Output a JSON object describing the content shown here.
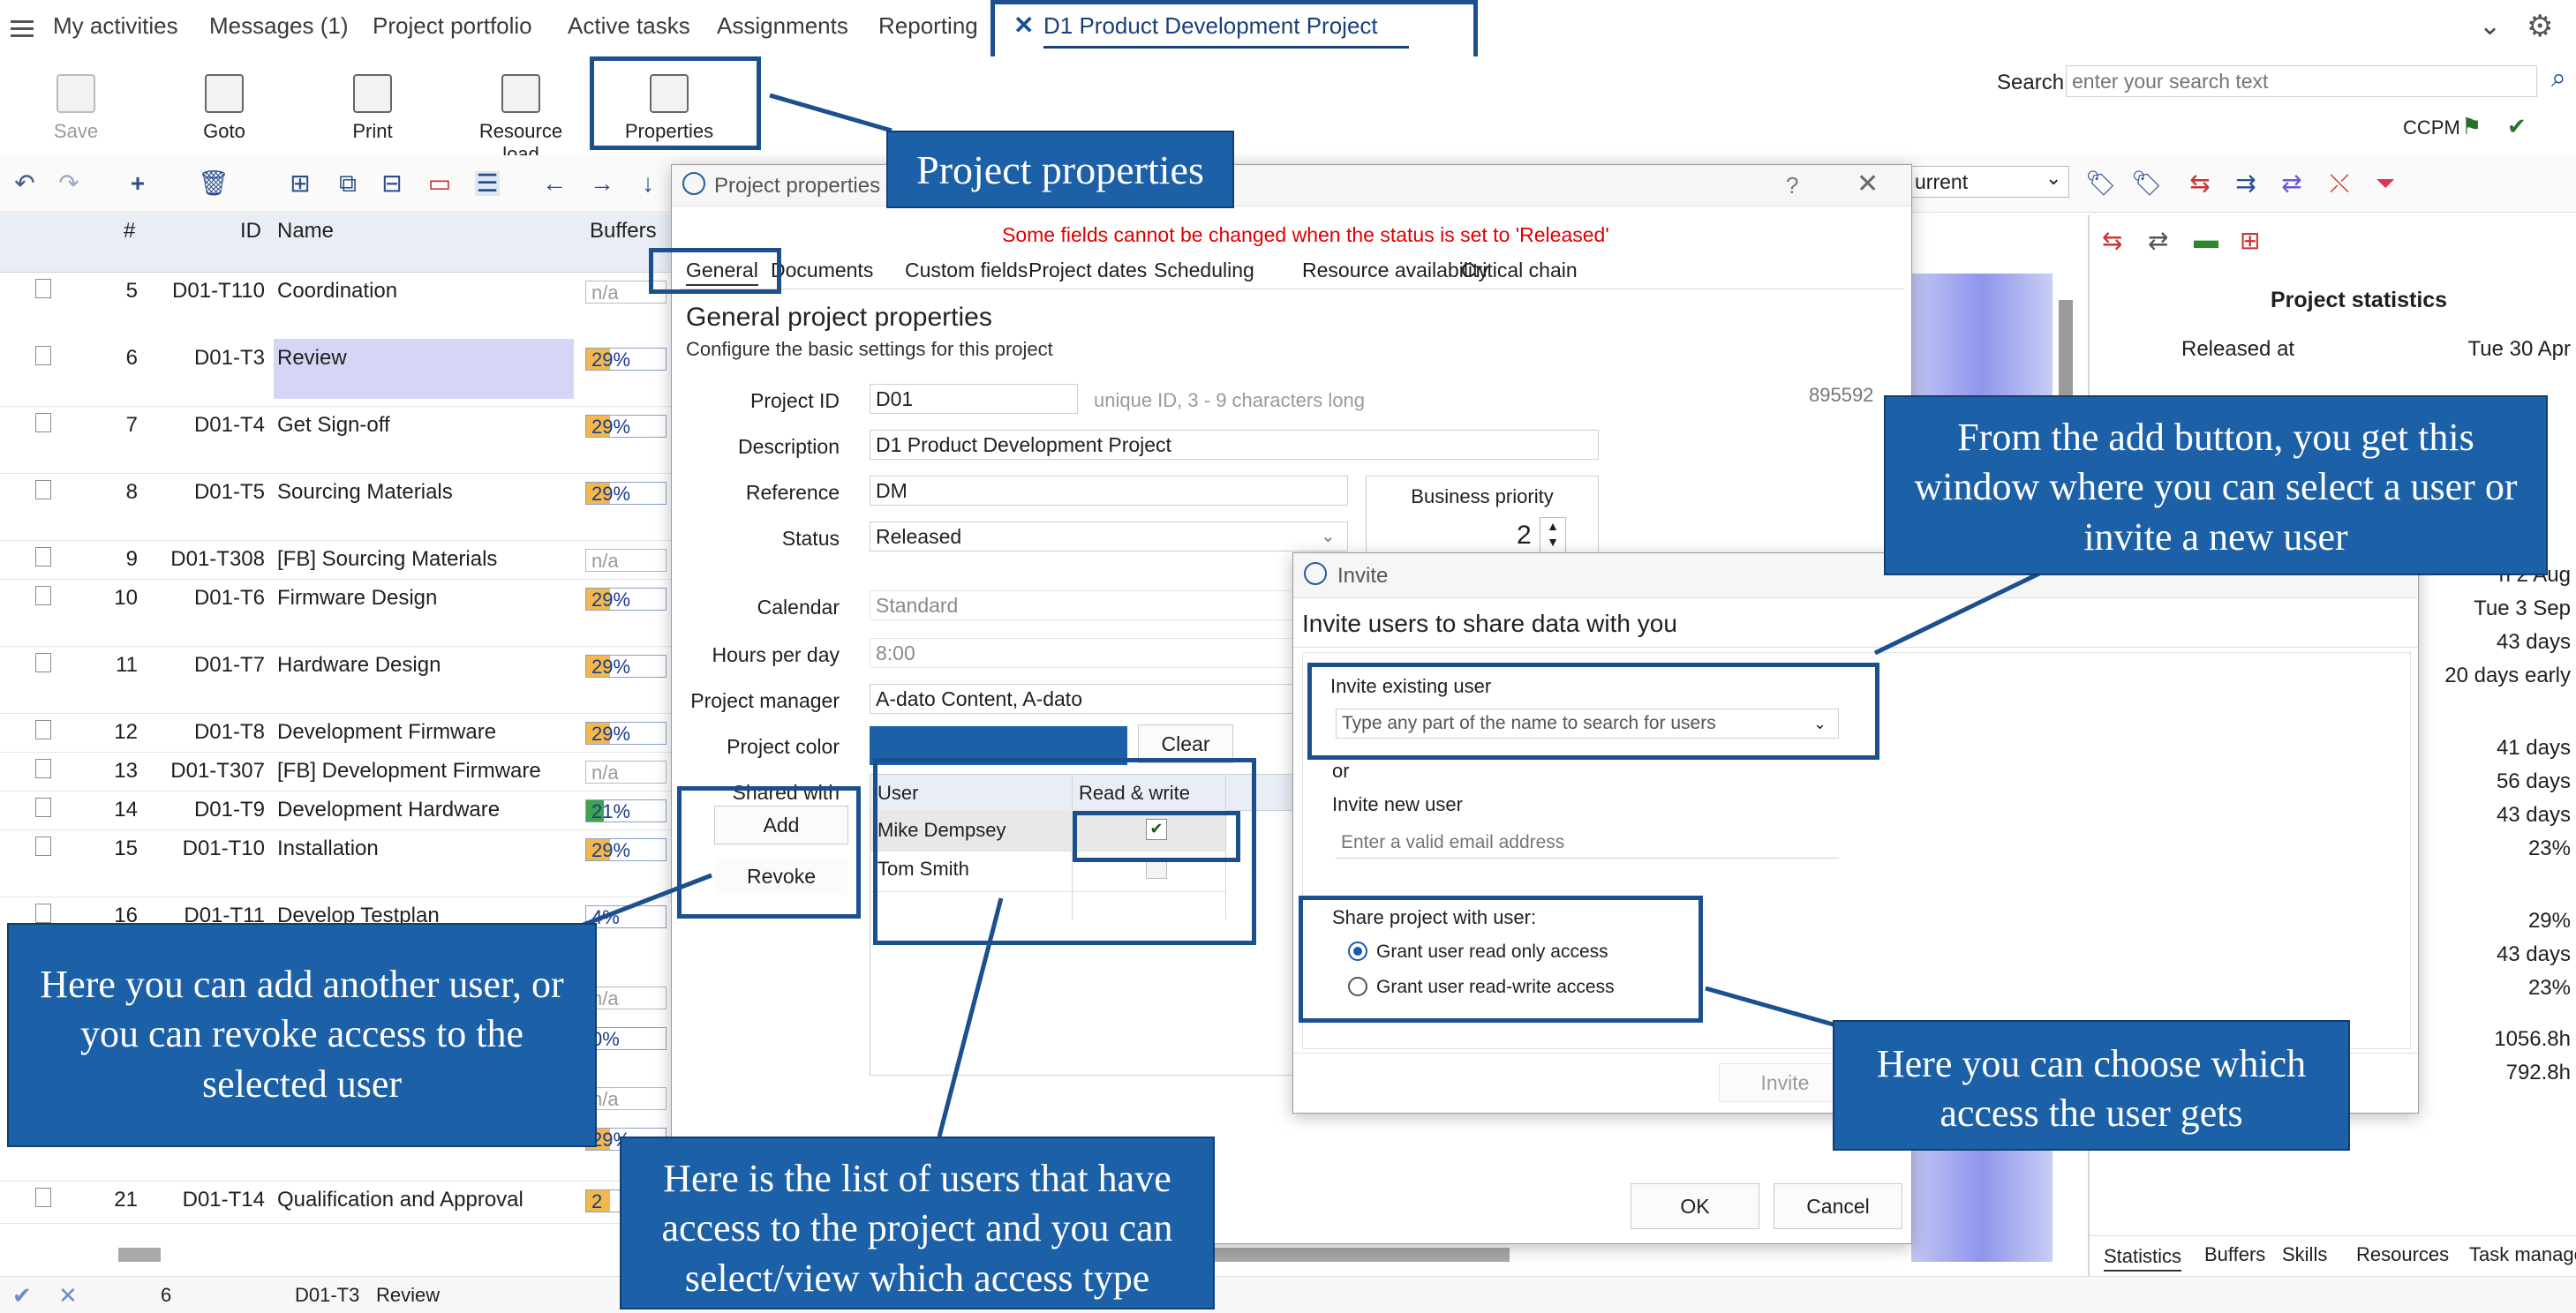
{
  "nav": {
    "items": [
      "My activities",
      "Messages (1)",
      "Project portfolio",
      "Active tasks",
      "Assignments",
      "Reporting"
    ],
    "active_tab": "D1 Product Development Project"
  },
  "ribbon": {
    "save": "Save",
    "goto": "Goto",
    "print": "Print",
    "resource_load": "Resource load",
    "properties": "Properties",
    "search_label": "Search",
    "search_placeholder": "enter your search text",
    "ccpm": "CCPM"
  },
  "toolbar": {
    "view_select": "urrent"
  },
  "grid": {
    "headers": {
      "num": "#",
      "id": "ID",
      "name": "Name",
      "buffers": "Buffers"
    },
    "rows": [
      {
        "num": "5",
        "id": "D01-T110",
        "name": "Coordination",
        "buffer": "n/a"
      },
      {
        "num": "6",
        "id": "D01-T3",
        "name": "Review",
        "buffer": "29%"
      },
      {
        "num": "7",
        "id": "D01-T4",
        "name": "Get Sign-off",
        "buffer": "29%"
      },
      {
        "num": "8",
        "id": "D01-T5",
        "name": "Sourcing Materials",
        "buffer": "29%"
      },
      {
        "num": "9",
        "id": "D01-T308",
        "name": "[FB]  Sourcing Materials",
        "buffer": "n/a"
      },
      {
        "num": "10",
        "id": "D01-T6",
        "name": "Firmware Design",
        "buffer": "29%"
      },
      {
        "num": "11",
        "id": "D01-T7",
        "name": "Hardware Design",
        "buffer": "29%"
      },
      {
        "num": "12",
        "id": "D01-T8",
        "name": "Development Firmware",
        "buffer": "29%"
      },
      {
        "num": "13",
        "id": "D01-T307",
        "name": "[FB]  Development Firmware",
        "buffer": "n/a"
      },
      {
        "num": "14",
        "id": "D01-T9",
        "name": "Development Hardware",
        "buffer": "21%"
      },
      {
        "num": "15",
        "id": "D01-T10",
        "name": "Installation",
        "buffer": "29%"
      },
      {
        "num": "16",
        "id": "D01-T11",
        "name": "Develop Testplan",
        "buffer": "4%"
      },
      {
        "num": "21",
        "id": "D01-T14",
        "name": "Qualification and Approval",
        "buffer": "2"
      }
    ],
    "hidden_buffers": [
      "n/a",
      "0%",
      "n/a",
      "29%"
    ],
    "status_bar": {
      "num": "6",
      "id": "D01-T3",
      "name": "Review"
    }
  },
  "right_panel": {
    "title": "Project statistics",
    "released_label": "Released at",
    "released_value": "Tue 30 Apr",
    "values": [
      "Tue 3 Sep",
      "43 days",
      "20 days early",
      "41 days",
      "56 days",
      "43 days",
      "23%",
      "29%",
      "43 days",
      "23%",
      "1056.8h",
      "792.8h"
    ],
    "partial_values": [
      "ri 2 Aug"
    ],
    "tabs": [
      "Statistics",
      "Buffers",
      "Skills",
      "Resources",
      "Task manager"
    ]
  },
  "project_dialog": {
    "title": "Project properties",
    "warning": "Some fields cannot be changed when the status is set to 'Released'",
    "tabs": [
      "General",
      "Documents",
      "Custom fields",
      "Project dates",
      "Scheduling",
      "Resource availability",
      "Critical chain"
    ],
    "heading": "General project properties",
    "subheading": "Configure the basic settings for this project",
    "fields": {
      "project_id_label": "Project ID",
      "project_id": "D01",
      "project_id_hint": "unique ID, 3 - 9 characters long",
      "internal_id": "895592",
      "description_label": "Description",
      "description": "D1 Product Development Project",
      "reference_label": "Reference",
      "reference": "DM",
      "status_label": "Status",
      "status": "Released",
      "priority_label": "Business priority",
      "priority": "2",
      "calendar_label": "Calendar",
      "calendar": "Standard",
      "hours_label": "Hours per day",
      "hours": "8:00",
      "pm_label": "Project manager",
      "pm": "A-dato Content, A-dato",
      "color_label": "Project color",
      "clear": "Clear",
      "shared_label": "Shared with"
    },
    "share_table": {
      "col_user": "User",
      "col_rw": "Read & write",
      "users": [
        "Mike Dempsey",
        "Tom Smith"
      ]
    },
    "add": "Add",
    "revoke": "Revoke",
    "ok": "OK",
    "cancel": "Cancel",
    "help": "?"
  },
  "invite_dialog": {
    "title": "Invite",
    "heading": "Invite users to share data with you",
    "existing_label": "Invite existing user",
    "existing_placeholder": "Type any part of the name to search for users",
    "or": "or",
    "new_label": "Invite new user",
    "new_placeholder": "Enter a valid email address",
    "share_label": "Share project with user:",
    "option_ro": "Grant user read only access",
    "option_rw": "Grant user read-write access",
    "invite_button": "Invite"
  },
  "callouts": {
    "properties": "Project properties",
    "add_user": "From the add button, you get this window where you can select a user or invite a new user",
    "add_revoke": "Here you can add another user, or you can revoke access to the selected user",
    "user_list": "Here is the list of users that have access to the project and you can select/view which access type",
    "access": "Here you can choose which access the user gets"
  },
  "colors": {
    "callout": "#1c60a8",
    "highlight": "#1b4f8e",
    "warning": "#e00000",
    "gantt": "#8f96ec"
  }
}
